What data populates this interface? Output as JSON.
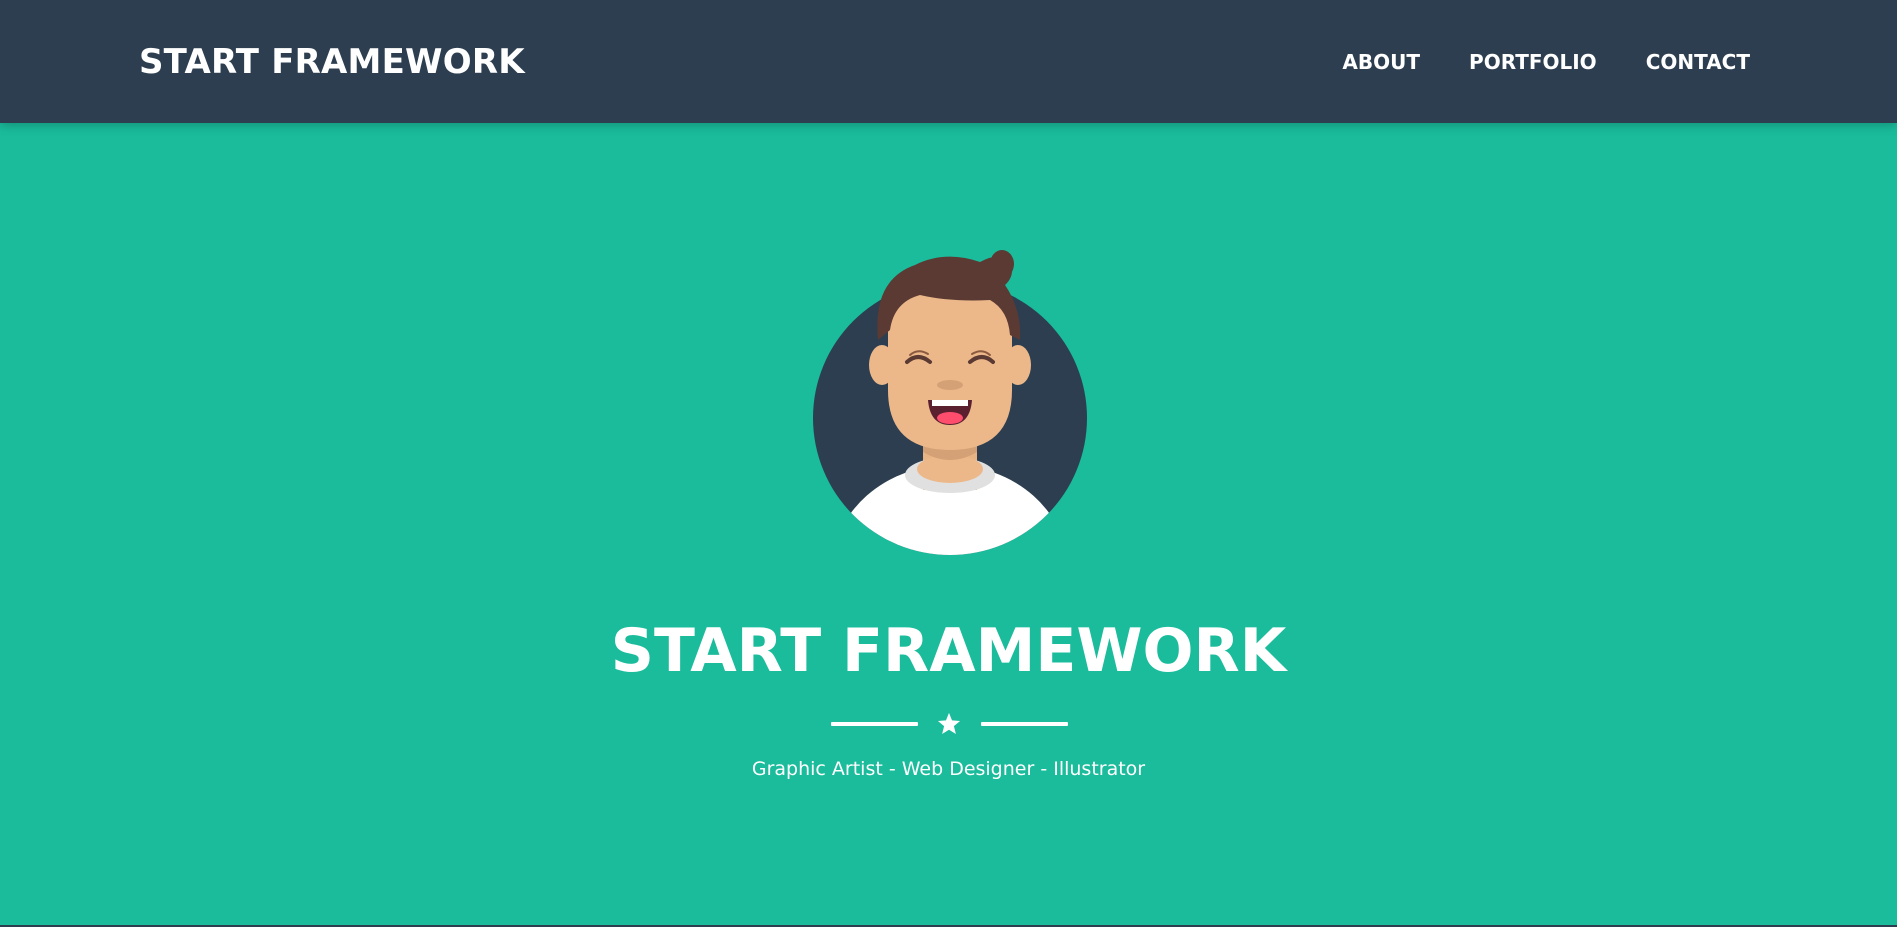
{
  "nav": {
    "brand": "START FRAMEWORK",
    "links": [
      {
        "label": "ABOUT"
      },
      {
        "label": "PORTFOLIO"
      },
      {
        "label": "CONTACT"
      }
    ]
  },
  "hero": {
    "avatar_icon": "avatar-illustration",
    "title": "START FRAMEWORK",
    "divider_icon": "star-icon",
    "subtitle": "Graphic Artist - Web Designer - Illustrator"
  },
  "colors": {
    "navbar": "#2c3e50",
    "primary": "#1abc9c",
    "text": "#ffffff"
  }
}
